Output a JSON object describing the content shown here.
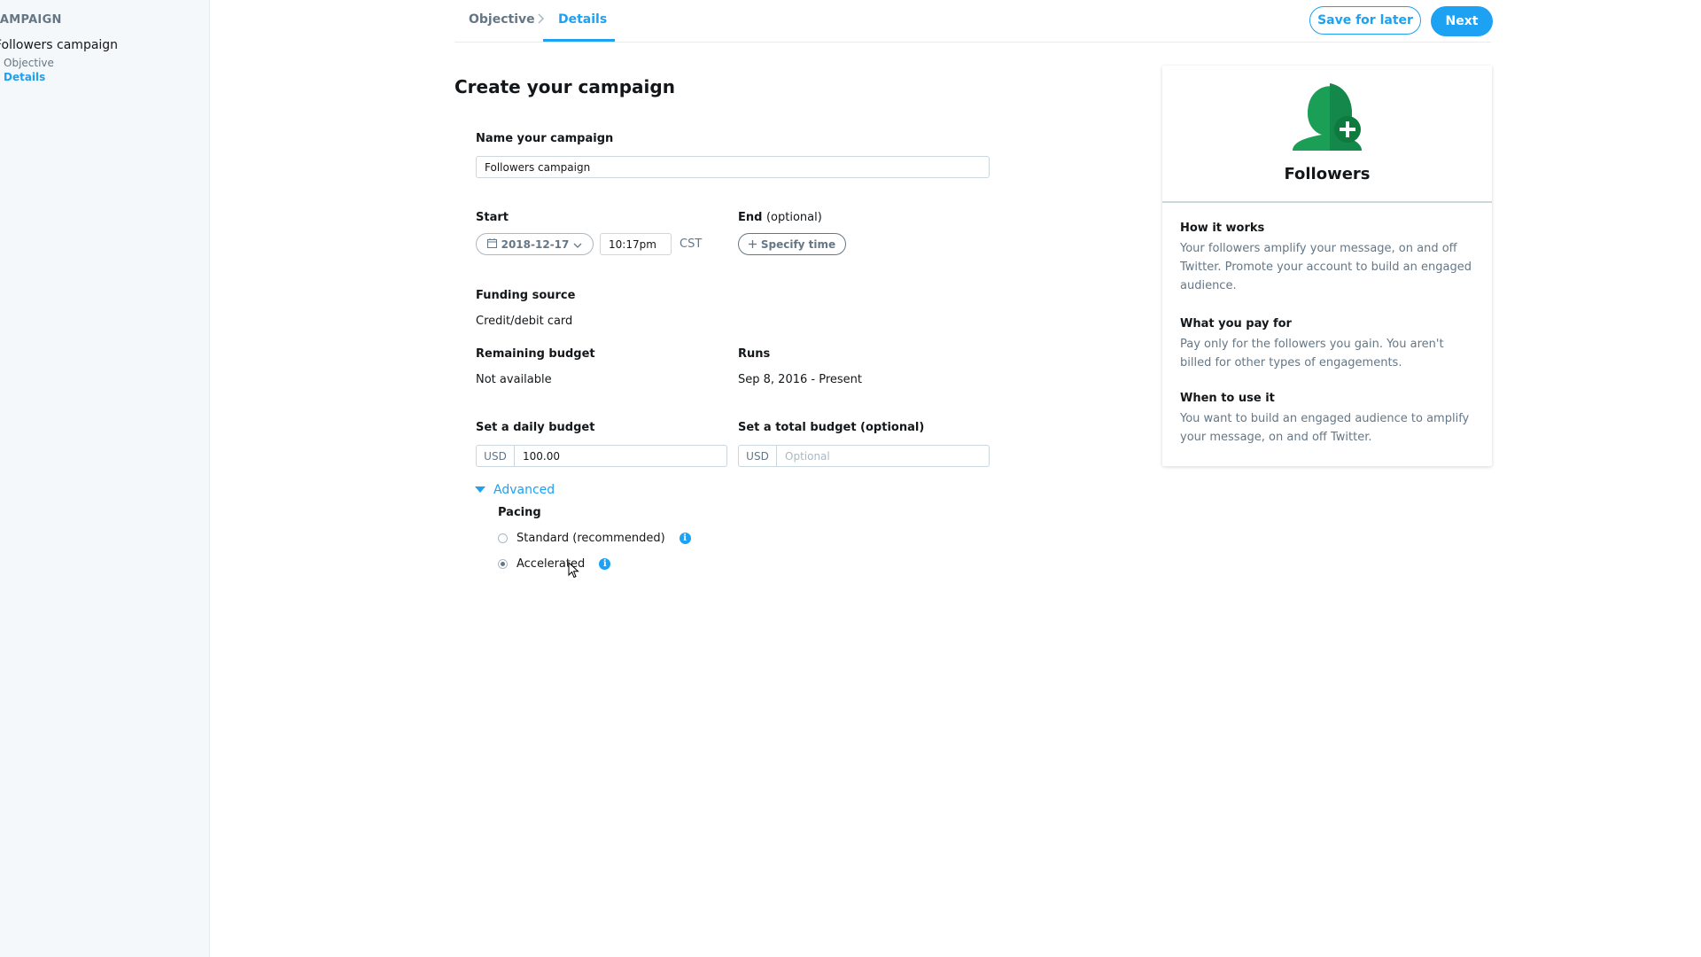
{
  "sidebar": {
    "heading": "CAMPAIGN",
    "campaign_name": "Followers campaign",
    "items": [
      {
        "label": "Objective"
      },
      {
        "label": "Details"
      }
    ]
  },
  "header": {
    "steps": [
      {
        "label": "Objective"
      },
      {
        "label": "Details"
      }
    ],
    "save_label": "Save for later",
    "next_label": "Next"
  },
  "form": {
    "title": "Create your campaign",
    "name_label": "Name your campaign",
    "name_value": "Followers campaign",
    "start_label": "Start",
    "start_date": "2018-12-17",
    "start_time": "10:17pm",
    "timezone": "CST",
    "end_label": "End",
    "end_optional": "(optional)",
    "specify_time_label": "Specify time",
    "funding_label": "Funding source",
    "funding_value": "Credit/debit card",
    "remaining_label": "Remaining budget",
    "remaining_value": "Not available",
    "runs_label": "Runs",
    "runs_value": "Sep 8, 2016 - Present",
    "daily_label": "Set a daily budget",
    "daily_currency": "USD",
    "daily_value": "100.00",
    "total_label": "Set a total budget (optional)",
    "total_currency": "USD",
    "total_placeholder": "Optional",
    "advanced_label": "Advanced",
    "pacing_label": "Pacing",
    "pacing_options": [
      {
        "label": "Standard (recommended)",
        "selected": false
      },
      {
        "label": "Accelerated",
        "selected": true
      }
    ]
  },
  "card": {
    "title": "Followers",
    "icon": "followers-add-icon",
    "icon_colors": [
      "#1b9e55",
      "#0f7a3e"
    ],
    "sections": [
      {
        "title": "How it works",
        "body": "Your followers amplify your message, on and off Twitter. Promote your account to build an engaged audience."
      },
      {
        "title": "What you pay for",
        "body": "Pay only for the followers you gain. You aren't billed for other types of engagements."
      },
      {
        "title": "When to use it",
        "body": "You want to build an engaged audience to amplify your message, on and off Twitter."
      }
    ]
  },
  "colors": {
    "accent": "#1da1f2",
    "text": "#14171a",
    "muted": "#657786"
  }
}
